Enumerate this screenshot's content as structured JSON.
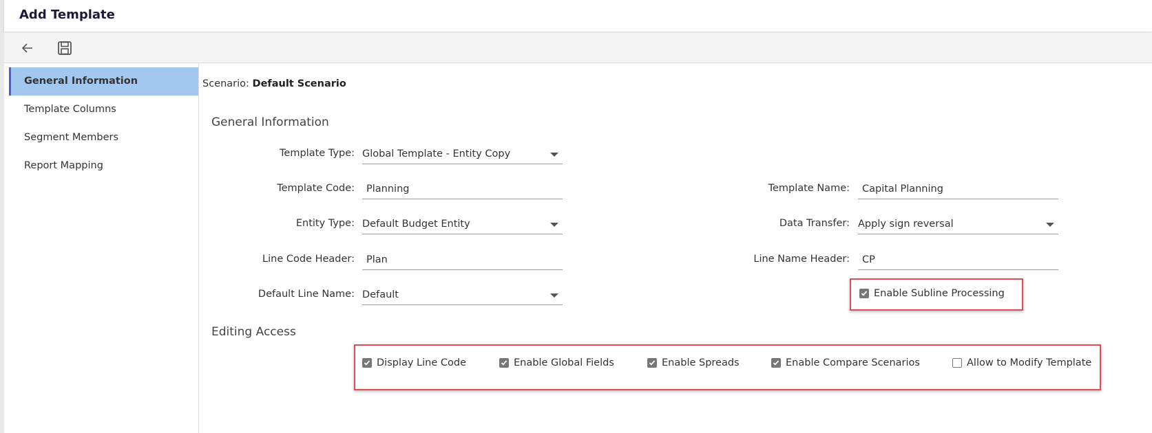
{
  "title": "Add Template",
  "toolbar": {
    "back_icon": "arrow-left-icon",
    "save_icon": "floppy-disk-icon"
  },
  "sidebar": {
    "items": [
      {
        "label": "General Information",
        "active": true
      },
      {
        "label": "Template Columns"
      },
      {
        "label": "Segment Members"
      },
      {
        "label": "Report Mapping"
      }
    ]
  },
  "scenario": {
    "label": "Scenario:",
    "value": "Default Scenario"
  },
  "general": {
    "heading": "General Information",
    "template_type": {
      "label": "Template Type:",
      "value": "Global Template - Entity Copy"
    },
    "template_code": {
      "label": "Template Code:",
      "value": "Planning"
    },
    "template_name": {
      "label": "Template Name:",
      "value": "Capital Planning"
    },
    "entity_type": {
      "label": "Entity Type:",
      "value": "Default Budget Entity"
    },
    "data_transfer": {
      "label": "Data Transfer:",
      "value": "Apply sign reversal"
    },
    "line_code_header": {
      "label": "Line Code Header:",
      "value": "Plan"
    },
    "line_name_header": {
      "label": "Line Name Header:",
      "value": "CP"
    },
    "default_line_name": {
      "label": "Default Line Name:",
      "value": "Default"
    },
    "subline": {
      "label": "Enable Subline Processing",
      "checked": true
    }
  },
  "editing": {
    "heading": "Editing Access",
    "options": [
      {
        "label": "Display Line Code",
        "checked": true
      },
      {
        "label": "Enable Global Fields",
        "checked": true
      },
      {
        "label": "Enable Spreads",
        "checked": true
      },
      {
        "label": "Enable Compare Scenarios",
        "checked": true
      },
      {
        "label": "Allow to Modify Template",
        "checked": false
      }
    ]
  },
  "colors": {
    "highlight": "#e84a4f",
    "active_nav": "#a3c8f0"
  }
}
